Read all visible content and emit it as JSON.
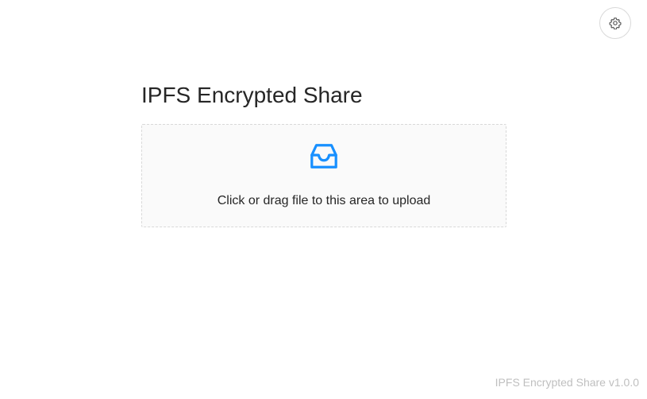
{
  "header": {
    "settings_icon": "gear-icon"
  },
  "main": {
    "title": "IPFS Encrypted Share",
    "upload": {
      "icon": "inbox-icon",
      "text": "Click or drag file to this area to upload",
      "accent_color": "#1890ff"
    }
  },
  "footer": {
    "version_text": "IPFS Encrypted Share v1.0.0"
  }
}
